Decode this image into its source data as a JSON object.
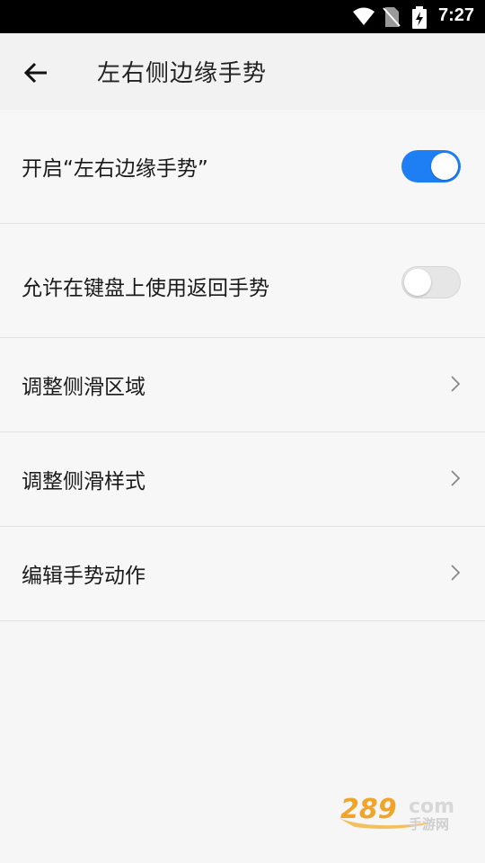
{
  "status_bar": {
    "time": "7:27",
    "icons": [
      "wifi-icon",
      "no-sim-icon",
      "battery-charging-icon"
    ]
  },
  "header": {
    "title": "左右侧边缘手势",
    "back_icon": "arrow-left-icon"
  },
  "settings": {
    "items": [
      {
        "label": "开启“左右边缘手势”",
        "type": "toggle",
        "enabled": true
      },
      {
        "label": "允许在键盘上使用返回手势",
        "type": "toggle",
        "enabled": false
      },
      {
        "label": "调整侧滑区域",
        "type": "nav",
        "icon": "chevron-right-icon"
      },
      {
        "label": "调整侧滑样式",
        "type": "nav",
        "icon": "chevron-right-icon"
      },
      {
        "label": "编辑手势动作",
        "type": "nav",
        "icon": "chevron-right-icon"
      }
    ]
  },
  "watermark": {
    "logo_text": "289.com 手游网"
  },
  "colors": {
    "accent": "#1e7ff5",
    "status_bar": "#000000",
    "background": "#f6f6f6",
    "divider": "#e2e2e2"
  }
}
